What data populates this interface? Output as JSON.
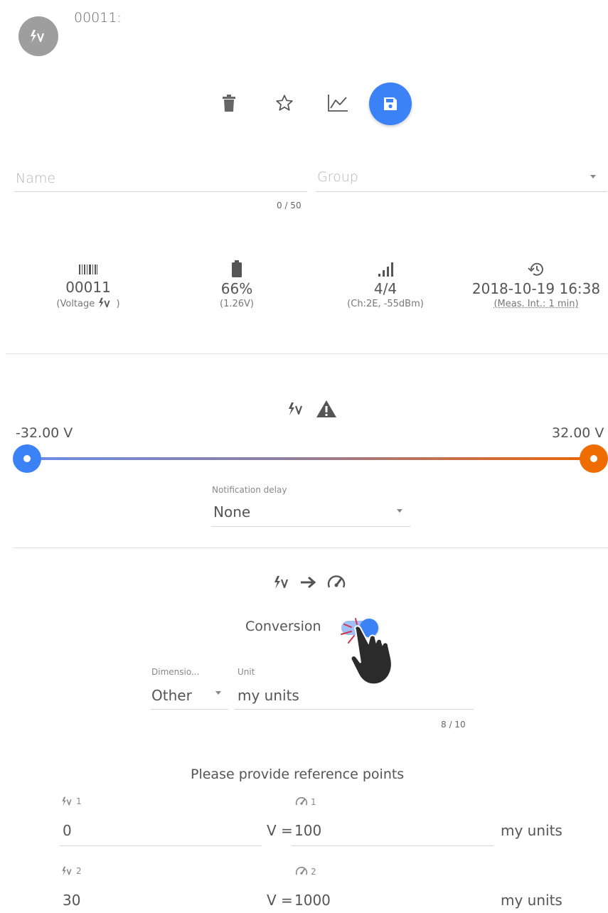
{
  "header": {
    "title": "00011:",
    "avatar_icon": "voltage-icon"
  },
  "toolbar": {
    "icons": [
      "trash-icon",
      "star-outline-icon",
      "chart-line-icon",
      "save-icon"
    ],
    "accent_color": "#3b82f6"
  },
  "form": {
    "name_placeholder": "Name",
    "group_placeholder": "Group",
    "name_counter": "0 / 50"
  },
  "stats": [
    {
      "icon": "barcode-icon",
      "value": "00011",
      "sub_prefix": "(Voltage ",
      "sub_suffix": " )"
    },
    {
      "icon": "battery-icon",
      "value": "66%",
      "sub": "(1.26V)"
    },
    {
      "icon": "signal-icon",
      "value": "4/4",
      "sub": "(Ch:2E, -55dBm)"
    },
    {
      "icon": "history-icon",
      "value": "2018-10-19 16:38",
      "sub": "(Meas. Int.: 1 min)"
    }
  ],
  "alarm": {
    "icons": [
      "voltage-icon",
      "warning-icon"
    ],
    "min_label": "-32.00 V",
    "max_label": "32.00 V",
    "min_color": "#3b82f6",
    "max_color": "#ef6c00",
    "delay_label": "Notification delay",
    "delay_value": "None"
  },
  "conversion": {
    "icons": [
      "voltage-icon",
      "arrow-right-icon",
      "gauge-icon"
    ],
    "toggle_label": "Conversion",
    "toggle_on": true,
    "dimension_label": "Dimensio...",
    "dimension_value": "Other",
    "unit_label": "Unit",
    "unit_value": "my units",
    "unit_counter": "8 / 10",
    "ref_title": "Please provide reference points",
    "points": [
      {
        "in_label": "1",
        "out_label": "1",
        "in_value": "0",
        "out_prefix": "V = ",
        "out_value": "100",
        "unit": "my units"
      },
      {
        "in_label": "2",
        "out_label": "2",
        "in_value": "30",
        "out_prefix": "V = ",
        "out_value": "1000",
        "unit": "my units"
      }
    ]
  }
}
